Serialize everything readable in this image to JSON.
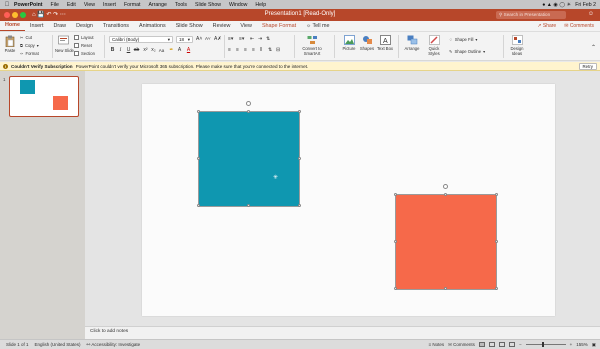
{
  "menubar": {
    "app": "PowerPoint",
    "items": [
      "File",
      "Edit",
      "View",
      "Insert",
      "Format",
      "Arrange",
      "Tools",
      "Slide Show",
      "Window",
      "Help"
    ],
    "clock": "Fri Feb 2"
  },
  "window": {
    "title": "Presentation1 [Read-Only]",
    "search_placeholder": "Search in Presentation"
  },
  "tabs": [
    "Home",
    "Insert",
    "Draw",
    "Design",
    "Transitions",
    "Animations",
    "Slide Show",
    "Review",
    "View",
    "Shape Format",
    "Tell me"
  ],
  "tabs_right": {
    "share": "Share",
    "comments": "Comments"
  },
  "ribbon": {
    "paste": "Paste",
    "cut": "Cut",
    "copy": "Copy",
    "format": "Format",
    "new_slide": "New Slide",
    "layout": "Layout",
    "reset": "Reset",
    "section": "Section",
    "font": "Calibri (Body)",
    "font_size": "18",
    "convert_smartart": "Convert to SmartArt",
    "picture": "Picture",
    "shapes": "Shapes",
    "text_box": "Text Box",
    "arrange": "Arrange",
    "quick_styles": "Quick Styles",
    "shape_fill": "Shape Fill",
    "shape_outline": "Shape Outline",
    "design_ideas": "Design Ideas"
  },
  "notification": {
    "title": "Couldn't Verify Subscription",
    "message": "PowerPoint couldn't verify your Microsoft 365 subscription. Please make sure that you're connected to the internet.",
    "retry": "Retry"
  },
  "thumbnail": {
    "number": "1"
  },
  "notes_placeholder": "Click to add notes",
  "statusbar": {
    "slide_info": "Slide 1 of 1",
    "language": "English (United States)",
    "accessibility": "Accessibility: Investigate",
    "notes": "Notes",
    "comments": "Comments",
    "zoom": "155%"
  },
  "colors": {
    "accent": "#b7472a",
    "teal_square": "#0f97b0",
    "orange_square": "#f6694a"
  }
}
